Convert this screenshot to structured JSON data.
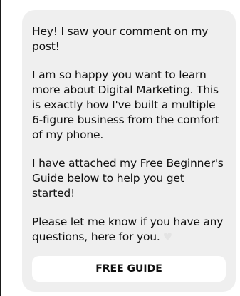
{
  "message": {
    "paragraphs": [
      "Hey! I saw your comment on my post!",
      "I am so happy you want to learn more about Digital Marketing. This is exactly how I've built a multiple 6-figure business from the comfort of my phone.",
      "I have attached my Free Beginner's Guide below to help you get started!",
      "Please let me know if you have any questions, here for you."
    ],
    "reaction_icon": "heart-icon"
  },
  "button": {
    "label": "FREE GUIDE"
  },
  "colors": {
    "bubble_background": "#efefef",
    "button_background": "#ffffff",
    "text": "#111111",
    "heart": "#e4e4e4"
  }
}
